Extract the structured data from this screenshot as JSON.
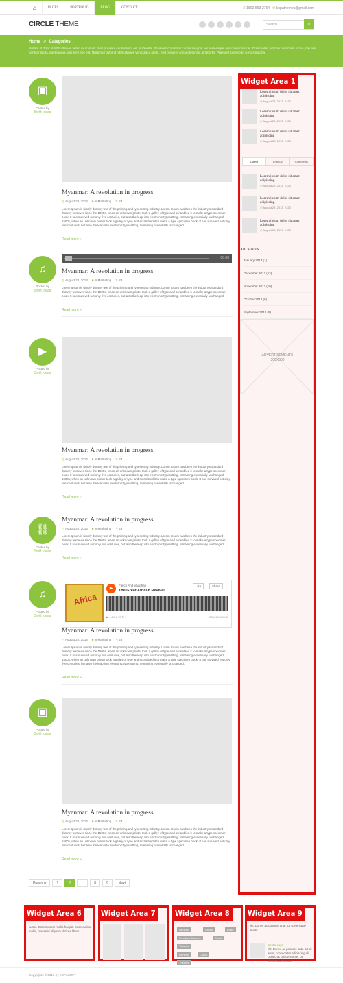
{
  "topbar": {
    "nav": [
      "PAGES",
      "PORTFOLIO",
      "BLOG",
      "CONTACT"
    ],
    "active": "BLOG",
    "phone": "1800-563-2764",
    "email": "kopathemes@gmail.com"
  },
  "header": {
    "logo_bold": "CIRCLE",
    "logo_rest": " THEME",
    "search_placeholder": "Search..."
  },
  "breadcrumb": {
    "home": "Home",
    "separator": ">",
    "current": "Categories",
    "description": "Nullam id dolor id nibh ultricies vehicula ut id elit. Sed posuere consectetur est at lobortis. Praesent commodo cursus magna, vel scelerisque nisl consectetur et. Duis mollis, est non commodo luctus, nisi erat porttitor ligula, eget lacinia odio sem nec elit. Nullam id dolor id nibh ultricies vehicula ut id elit. Sed posuere consectetur est at lobortis. Praesent commodo cursus magna."
  },
  "posts": {
    "posted_by": "Posted by",
    "author": "Swift Ideas",
    "title": "Myanmar: A revolution in progress",
    "date": "August 22, 2013",
    "category": "in Marketing",
    "comments": "23",
    "read_more": "Read more »",
    "excerpt": "Lorem Ipsum is simply dummy text of the printing and typesetting industry. Lorem Ipsum has been the industry's standard dummy text ever since the 1500s, when an unknown printer took a galley of type and scrambled it to make a type specimen book. It has survived not only five centuries, but also the leap into electronic typesetting, remaining essentially unchanged. 1500s, when an unknown printer took a galley of type and scrambled it to make a type specimen book. It has survived not only five centuries, but also the leap into electronic typesetting, remaining essentially unchanged.",
    "excerpt_short": "Lorem Ipsum is simply dummy text of the printing and typesetting industry. Lorem Ipsum has been the industry's standard dummy text ever since the 1500s, when an unknown printer took a galley of type and scrambled it to make a type specimen book. It has survived not only five centuries, but also the leap into electronic typesetting, remaining essentially unchanged.",
    "icons": [
      "image-icon",
      "headphones-icon",
      "video-icon",
      "link-icon",
      "headphones-icon",
      "image-icon"
    ]
  },
  "audio": {
    "time": "00:00"
  },
  "soundcloud": {
    "artist": "Fletch And Vaughan",
    "track": "The Great African Revival",
    "like": "Like",
    "share": "Share",
    "stats": "▶ 4.6K   ♥ 15   ↻ 1",
    "brand": "SOUNDCLOUD",
    "art_text": "Africa"
  },
  "pagination": [
    "Previous",
    "1",
    "2",
    "...",
    "8",
    "9",
    "Next"
  ],
  "pagination_current": "2",
  "sidebar": {
    "label": "Widget Area 1",
    "item_title": "Lorem ipsum dolor sit amet adipiscing",
    "item_date": "August 22, 2013",
    "item_comments": "23",
    "tabs": [
      "Latest",
      "Popular",
      "Comments"
    ],
    "archives_title": "ARCHIVES",
    "archives": [
      "January 2013 (1)",
      "December 2012 (12)",
      "November 2012 (10)",
      "October 2012 (8)",
      "September 2012 (5)"
    ],
    "ad_line1": "ADVERTISEMENTS",
    "ad_line2": "300X300"
  },
  "footer_widgets": {
    "w6": {
      "label": "Widget Area 6",
      "text": "luctus. Cras semper mollis feugiat. Suspendisse mollis, massa id aliquam ultrices libero..."
    },
    "w7": {
      "label": "Widget Area 7"
    },
    "w8": {
      "label": "Widget Area 8",
      "tags": [
        "Generic",
        "Chuck",
        "Entre",
        "Premium Themes",
        "Chuck",
        "Themes",
        "Generic",
        "Chuck",
        "Themes"
      ]
    },
    "w9": {
      "label": "Widget Area 9",
      "text1": "elit. Donec ac posuere ante. Ut scelerisque luctus.",
      "name": "Dental says",
      "text2": "elit. Donec ac posuere ante. Ut sit amet, consectetur adipiscing elit. Donec ac posuere ante. Ut scelerisque luctus."
    }
  },
  "footer": {
    "copyright": "Copyrights © 2013 by KOPASOFT"
  },
  "colors": {
    "accent": "#8cc43f",
    "annotation": "#e01010"
  }
}
